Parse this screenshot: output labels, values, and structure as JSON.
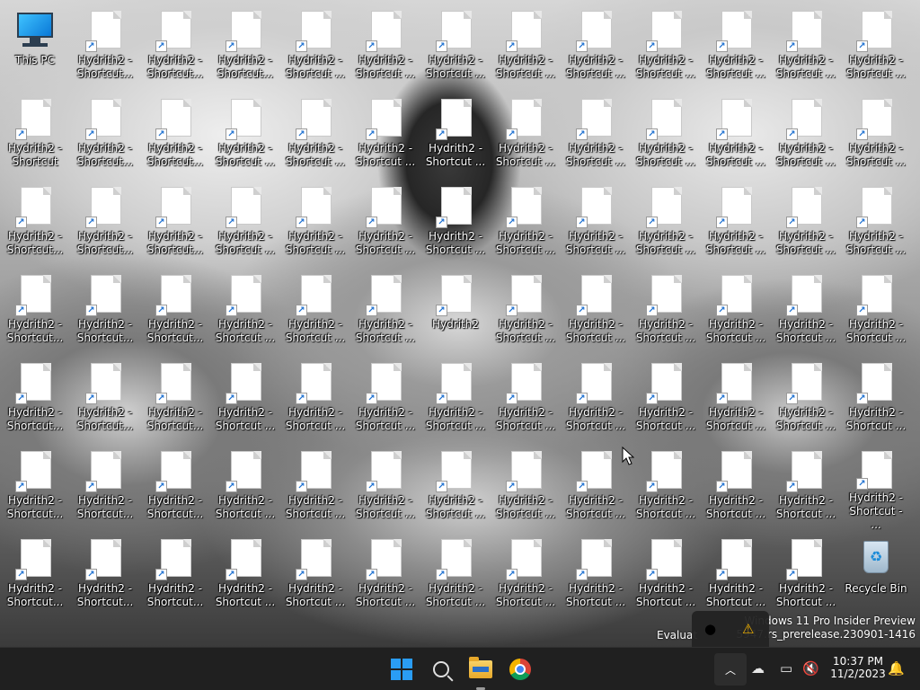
{
  "desktop": {
    "this_pc_label": "This PC",
    "recycle_bin_label": "Recycle Bin",
    "rows": [
      [
        "Hydrith2 - Shortcut...",
        "Hydrith2 - Shortcut...",
        "Hydrith2 - Shortcut...",
        "Hydrith2 - Shortcut ...",
        "Hydrith2 - Shortcut ...",
        "Hydrith2 - Shortcut ...",
        "Hydrith2 - Shortcut ...",
        "Hydrith2 - Shortcut ...",
        "Hydrith2 - Shortcut ...",
        "Hydrith2 - Shortcut ...",
        "Hydrith2 - Shortcut ...",
        "Hydrith2 - Shortcut ..."
      ],
      [
        "Hydrith2 - Shortcut",
        "Hydrith2 - Shortcut...",
        "Hydrith2 - Shortcut...",
        "Hydrith2 - Shortcut ...",
        "Hydrith2 - Shortcut ...",
        "Hydrith2 - Shortcut ...",
        "Hydrith2 - Shortcut ...",
        "Hydrith2 - Shortcut ...",
        "Hydrith2 - Shortcut ...",
        "Hydrith2 - Shortcut ...",
        "Hydrith2 - Shortcut ...",
        "Hydrith2 - Shortcut ...",
        "Hydrith2 - Shortcut ..."
      ],
      [
        "Hydrith2 - Shortcut...",
        "Hydrith2 - Shortcut...",
        "Hydrith2 - Shortcut...",
        "Hydrith2 - Shortcut ...",
        "Hydrith2 - Shortcut ...",
        "Hydrith2 - Shortcut ...",
        "Hydrith2 - Shortcut ...",
        "Hydrith2 - Shortcut ...",
        "Hydrith2 - Shortcut ...",
        "Hydrith2 - Shortcut ...",
        "Hydrith2 - Shortcut ...",
        "Hydrith2 - Shortcut ...",
        "Hydrith2 - Shortcut ..."
      ],
      [
        "Hydrith2 - Shortcut...",
        "Hydrith2 - Shortcut...",
        "Hydrith2 - Shortcut...",
        "Hydrith2 - Shortcut ...",
        "Hydrith2 - Shortcut ...",
        "Hydrith2 - Shortcut ...",
        "Hydrith2",
        "Hydrith2 - Shortcut ...",
        "Hydrith2 - Shortcut ...",
        "Hydrith2 - Shortcut ...",
        "Hydrith2 - Shortcut ...",
        "Hydrith2 - Shortcut ...",
        "Hydrith2 - Shortcut ..."
      ],
      [
        "Hydrith2 - Shortcut...",
        "Hydrith2 - Shortcut...",
        "Hydrith2 - Shortcut...",
        "Hydrith2 - Shortcut ...",
        "Hydrith2 - Shortcut ...",
        "Hydrith2 - Shortcut ...",
        "Hydrith2 - Shortcut ...",
        "Hydrith2 - Shortcut ...",
        "Hydrith2 - Shortcut ...",
        "Hydrith2 - Shortcut ...",
        "Hydrith2 - Shortcut ...",
        "Hydrith2 - Shortcut ...",
        "Hydrith2 - Shortcut ..."
      ],
      [
        "Hydrith2 - Shortcut...",
        "Hydrith2 - Shortcut...",
        "Hydrith2 - Shortcut...",
        "Hydrith2 - Shortcut ...",
        "Hydrith2 - Shortcut ...",
        "Hydrith2 - Shortcut ...",
        "Hydrith2 - Shortcut ...",
        "Hydrith2 - Shortcut ...",
        "Hydrith2 - Shortcut ...",
        "Hydrith2 - Shortcut ...",
        "Hydrith2 - Shortcut ...",
        "Hydrith2 - Shortcut ...",
        "Hydrith2 - Shortcut - ..."
      ],
      [
        "Hydrith2 - Shortcut...",
        "Hydrith2 - Shortcut...",
        "Hydrith2 - Shortcut...",
        "Hydrith2 - Shortcut ...",
        "Hydrith2 - Shortcut ...",
        "Hydrith2 - Shortcut ...",
        "Hydrith2 - Shortcut ...",
        "Hydrith2 - Shortcut ...",
        "Hydrith2 - Shortcut ...",
        "Hydrith2 - Shortcut ...",
        "Hydrith2 - Shortcut ...",
        "Hydrith2 - Shortcut ..."
      ]
    ]
  },
  "watermark": {
    "line1": "Windows 11 Pro Insider Preview",
    "line2": "Evaluat",
    "line3": "5947.rs_prerelease.230901-1416"
  },
  "taskbar": {
    "icons": [
      "windows-start-icon",
      "search-icon",
      "file-explorer-icon",
      "chrome-icon"
    ],
    "tray_icons": [
      "chevron-up-icon",
      "onedrive-icon",
      "network-icon",
      "volume-muted-icon",
      "notification-bell-icon"
    ],
    "popup_icons": [
      "chrome-tray-icon",
      "security-warning-icon"
    ],
    "time": "10:37 PM",
    "date": "11/2/2023",
    "accent": "#2a9df4"
  }
}
